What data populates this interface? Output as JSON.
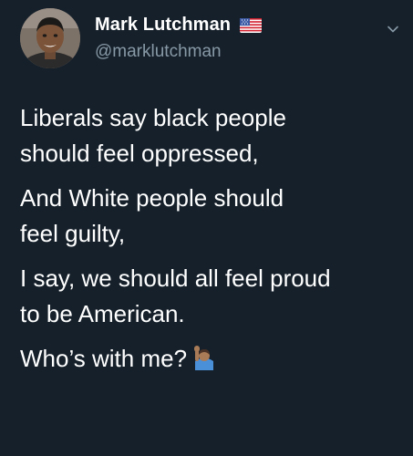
{
  "author": {
    "display_name": "Mark Lutchman",
    "handle": "@marklutchman",
    "badge_icon": "us-flag-icon"
  },
  "menu_icon": "chevron-down-icon",
  "tweet": {
    "paragraphs": [
      {
        "lines": [
          "Liberals say black people",
          "should feel oppressed,"
        ]
      },
      {
        "lines": [
          "And White people should",
          "feel guilty,"
        ]
      },
      {
        "lines": [
          "I say, we should all feel proud",
          "to be American."
        ]
      },
      {
        "lines": [
          "Who’s with me?"
        ]
      }
    ],
    "trailing_emoji": "person-raising-hand-icon"
  },
  "colors": {
    "background": "#15202b",
    "text": "#ffffff",
    "secondary_text": "#8899a6"
  }
}
